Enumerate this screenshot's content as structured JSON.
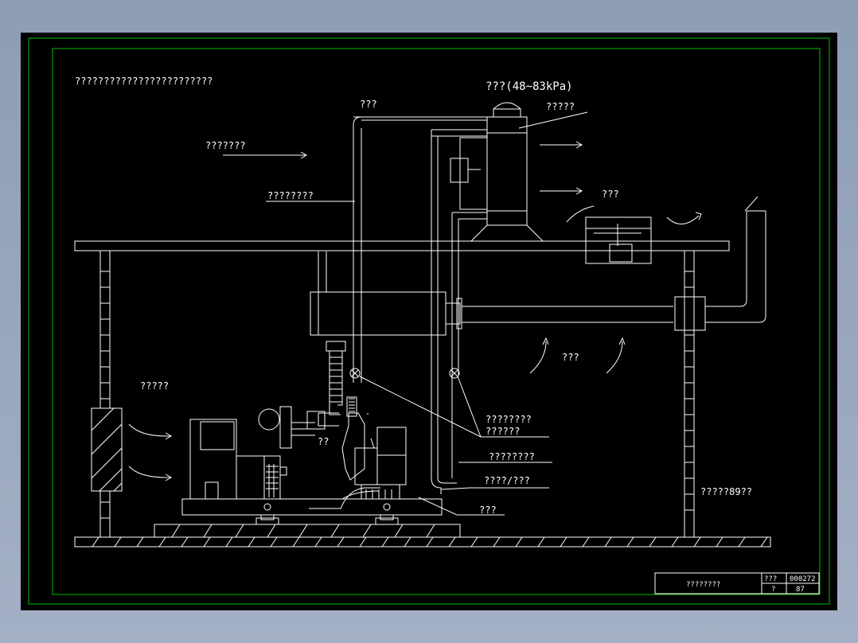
{
  "colors": {
    "background": "#000000",
    "frame": "#00c000",
    "lines": "#ffffff"
  },
  "labels": {
    "title": "????????????????????????",
    "pressure": "???(48~83kPa)",
    "top_pipe": "???",
    "device_top": "?????",
    "air_flow": "???????",
    "pipe_left": "????????",
    "right_flow": "???",
    "middle_flow": "???",
    "left_intake": "?????",
    "engine": "??",
    "valve_a": "????????",
    "valve_b": "??????",
    "pipe_c": "????????",
    "pipe_d": "????/???",
    "base": "???",
    "right_note": "?????89??"
  },
  "title_block": {
    "name": "????????",
    "code_label": "???",
    "code": "000272",
    "page_label": "?",
    "page": "87"
  }
}
